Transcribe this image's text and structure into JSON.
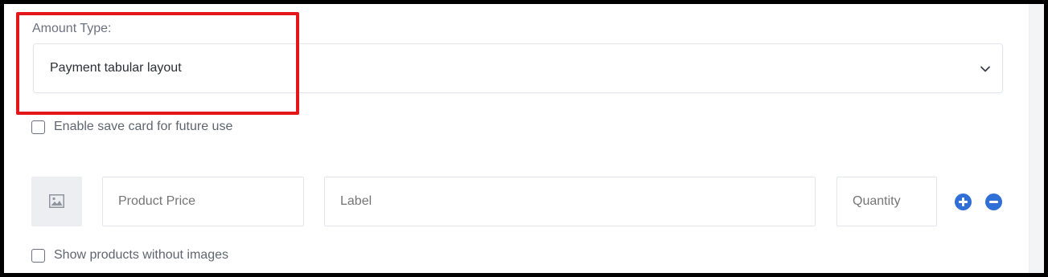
{
  "amount_type": {
    "label": "Amount Type:",
    "selected_value": "Payment tabular layout"
  },
  "save_card": {
    "label": "Enable save card for future use",
    "checked": false
  },
  "product_row": {
    "price_placeholder": "Product Price",
    "label_placeholder": "Label",
    "quantity_placeholder": "Quantity"
  },
  "show_without_images": {
    "label": "Show products without images",
    "checked": false
  },
  "colors": {
    "highlight": "#e3161a",
    "accent": "#2f6fd6"
  },
  "icons": {
    "select_toggle": "chevron-down-icon",
    "image_placeholder": "image-icon",
    "add": "plus-circle-icon",
    "remove": "minus-circle-icon"
  }
}
